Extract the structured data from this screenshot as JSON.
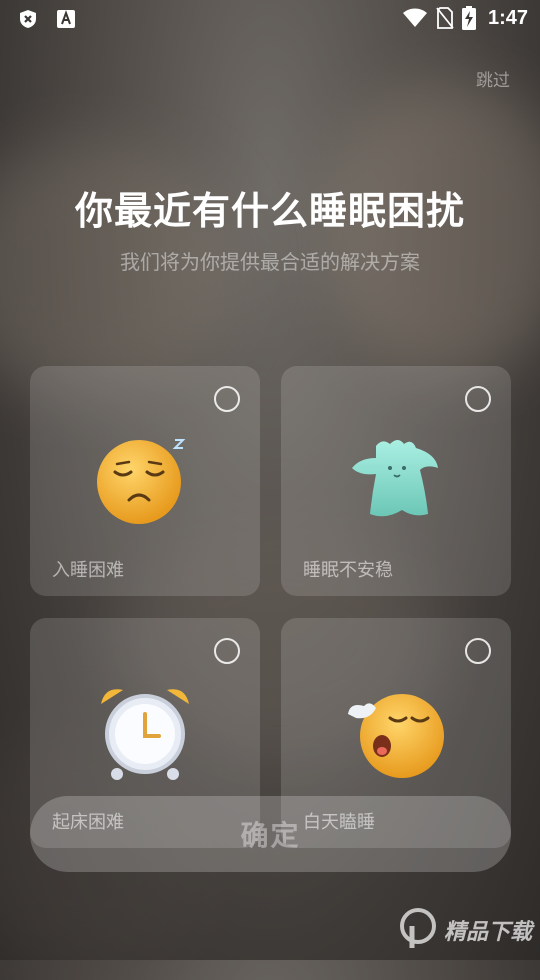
{
  "status_bar": {
    "time": "1:47",
    "left_icons": [
      "shield-x-icon",
      "font-a-icon"
    ],
    "right_icons": [
      "wifi-icon",
      "no-sim-icon",
      "battery-charging-icon"
    ]
  },
  "header": {
    "skip_label": "跳过",
    "title": "你最近有什么睡眠困扰",
    "subtitle": "我们将为你提供最合适的解决方案"
  },
  "options": [
    {
      "label": "入睡困难",
      "icon": "sleepy-face-icon",
      "selected": false
    },
    {
      "label": "睡眠不安稳",
      "icon": "ghost-blob-icon",
      "selected": false
    },
    {
      "label": "起床困难",
      "icon": "alarm-clock-icon",
      "selected": false
    },
    {
      "label": "白天瞌睡",
      "icon": "yawning-face-icon",
      "selected": false
    }
  ],
  "confirm_label": "确定",
  "watermark": {
    "text": "精品下载"
  },
  "colors": {
    "accent_yellow": "#f2b738",
    "ghost_teal": "#8fdcd0",
    "clock_pink": "#f7d7d2"
  }
}
